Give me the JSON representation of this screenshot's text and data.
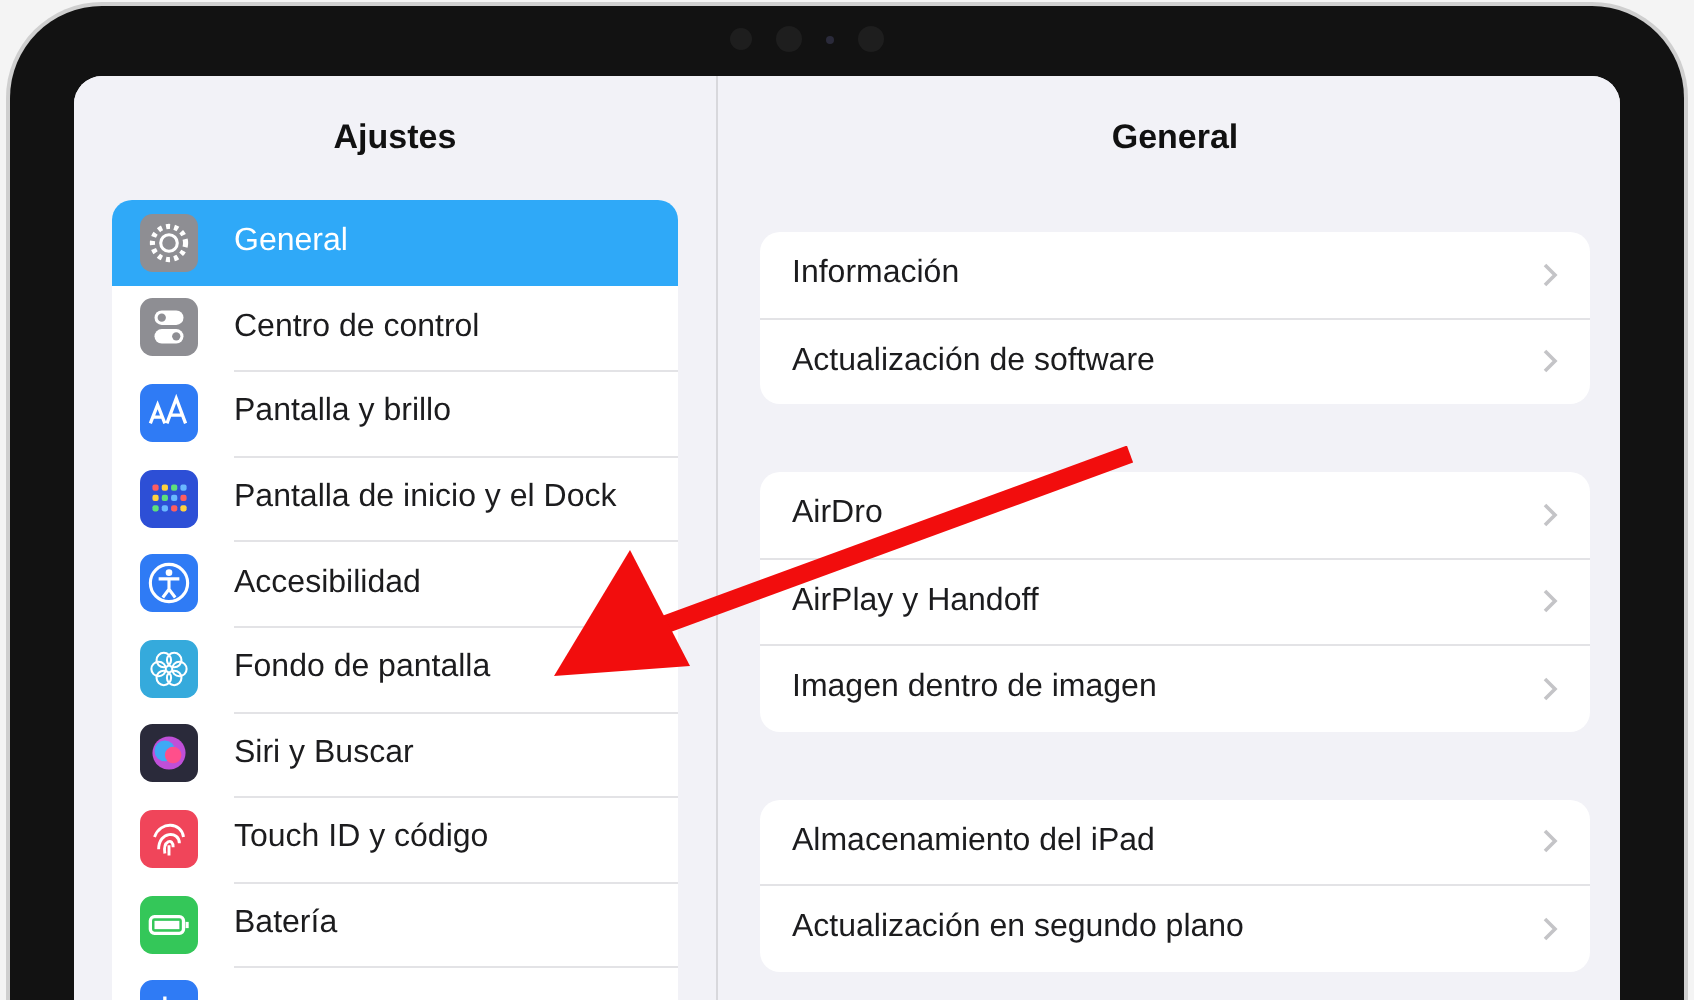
{
  "sidebar": {
    "title": "Ajustes",
    "items": [
      {
        "label": "General",
        "selected": true,
        "color": "#8e8e93"
      },
      {
        "label": "Centro de control",
        "selected": false,
        "color": "#8e8e93"
      },
      {
        "label": "Pantalla y brillo",
        "selected": false,
        "color": "#2f7bf5"
      },
      {
        "label": "Pantalla de inicio y el Dock",
        "selected": false,
        "color": "#2d4fd6"
      },
      {
        "label": "Accesibilidad",
        "selected": false,
        "color": "#2f7bf5"
      },
      {
        "label": "Fondo de pantalla",
        "selected": false,
        "color": "#35aadc"
      },
      {
        "label": "Siri y Buscar",
        "selected": false,
        "color": "#2a2a3a"
      },
      {
        "label": "Touch ID y código",
        "selected": false,
        "color": "#f0455a"
      },
      {
        "label": "Batería",
        "selected": false,
        "color": "#34c759"
      },
      {
        "selected": false,
        "color": "#2f7bf5"
      }
    ]
  },
  "detail": {
    "title": "General",
    "groups": [
      [
        "Información",
        "Actualización de software"
      ],
      [
        "AirDro",
        "AirPlay y Handoff",
        "Imagen dentro de imagen"
      ],
      [
        "Almacenamiento del iPad",
        "Actualización en segundo plano"
      ]
    ]
  }
}
